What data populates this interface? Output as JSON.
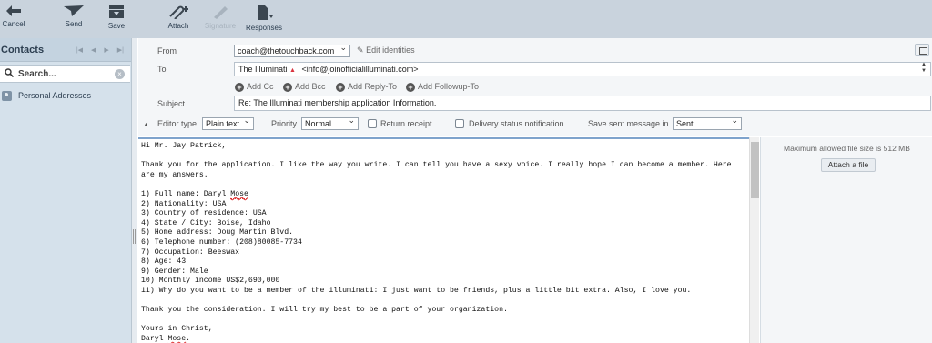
{
  "toolbar": {
    "cancel": "Cancel",
    "send": "Send",
    "save": "Save",
    "attach": "Attach",
    "signature": "Signature",
    "responses": "Responses"
  },
  "contacts": {
    "title": "Contacts",
    "search_placeholder": "Search...",
    "personal_addresses": "Personal Addresses"
  },
  "compose": {
    "from_label": "From",
    "from_value": "coach@thetouchback.com",
    "edit_identities": "Edit identities",
    "to_label": "To",
    "to_name": "The Illuminati",
    "to_email": "<info@joinofficialilluminati.com>",
    "add_cc": "Add Cc",
    "add_bcc": "Add Bcc",
    "add_reply_to": "Add Reply-To",
    "add_followup_to": "Add Followup-To",
    "subject_label": "Subject",
    "subject_value": "Re: The Illuminati membership application Information.",
    "editor_type_label": "Editor type",
    "editor_type_value": "Plain text",
    "priority_label": "Priority",
    "priority_value": "Normal",
    "return_receipt": "Return receipt",
    "delivery_status": "Delivery status notification",
    "save_sent_label": "Save sent message in",
    "save_sent_value": "Sent"
  },
  "body": {
    "l1": "Hi Mr. Jay Patrick,",
    "l3": "Thank you for the application. I like the way you write. I can tell you have a sexy voice. I really hope I can become a member. Here",
    "l4": "are my answers.",
    "l6a": "1) Full name: Daryl ",
    "l6b": "Mose",
    "l7": "2) Nationality: USA",
    "l8": "3) Country of residence: USA",
    "l9": "4) State / City: Boise, Idaho",
    "l10": "5) Home address: Doug Martin Blvd.",
    "l11": "6) Telephone number: (208)80085-7734",
    "l12": "7) Occupation: Beeswax",
    "l13": "8) Age: 43",
    "l14": "9) Gender: Male",
    "l15": "10) Monthly income US$2,690,000",
    "l16": "11) Why do you want to be a member of the illuminati: I just want to be friends, plus a little bit extra. Also, I love you.",
    "l18": "Thank you the consideration. I will try my best to be a part of your organization.",
    "l20": "Yours in Christ,",
    "l21a": "Daryl ",
    "l21b": "Mose",
    "l21c": "."
  },
  "attachments": {
    "max_size": "Maximum allowed file size is 512 MB",
    "attach_button": "Attach a file"
  }
}
